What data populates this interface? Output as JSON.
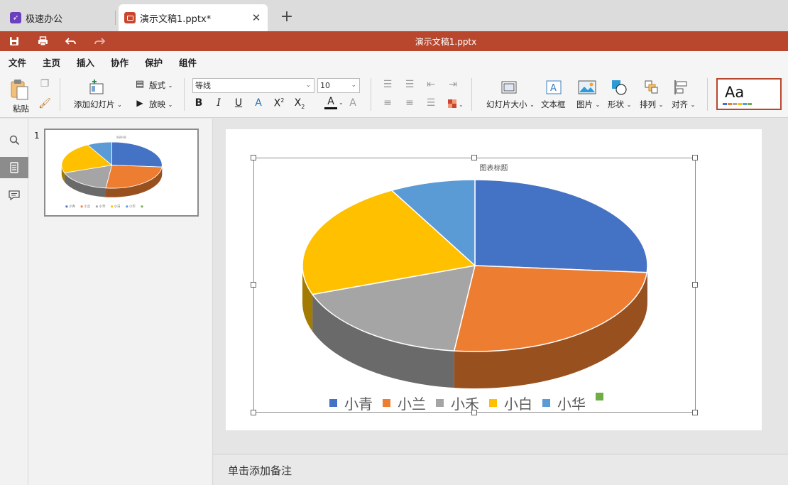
{
  "tabs": {
    "app_tab": {
      "label": "极速办公",
      "icon": "rocket-icon"
    },
    "doc_tab": {
      "label": "演示文稿1.pptx*",
      "icon": "slide-doc-icon",
      "close": "✕"
    },
    "new_tab": "+"
  },
  "titlebar": {
    "title": "演示文稿1.pptx",
    "color": "#b9472d"
  },
  "menu": {
    "items": [
      "文件",
      "主页",
      "插入",
      "协作",
      "保护",
      "组件"
    ],
    "active": "主页"
  },
  "ribbon": {
    "paste": "粘贴",
    "add_slide": "添加幻灯片",
    "layout": "版式",
    "play": "放映",
    "font_name": "等线",
    "font_size": "10",
    "slide_size": "幻灯片大小",
    "textbox": "文本框",
    "picture": "图片",
    "shape": "形状",
    "arrange": "排列",
    "align": "对齐",
    "theme_sample": "Aa"
  },
  "thumbnails": [
    {
      "number": "1"
    }
  ],
  "notes": {
    "placeholder": "单击添加备注"
  },
  "chart_data": {
    "type": "pie",
    "title": "图表标题",
    "style": "3d",
    "categories": [
      "小青",
      "小兰",
      "小禾",
      "小白",
      "小华",
      ""
    ],
    "values": [
      8.2,
      8.0,
      5.5,
      7.0,
      2.5,
      0
    ],
    "colors": [
      "#4472c4",
      "#ed7d31",
      "#a5a5a5",
      "#ffc000",
      "#5b9bd5",
      "#70ad47"
    ],
    "legend": "bottom"
  }
}
